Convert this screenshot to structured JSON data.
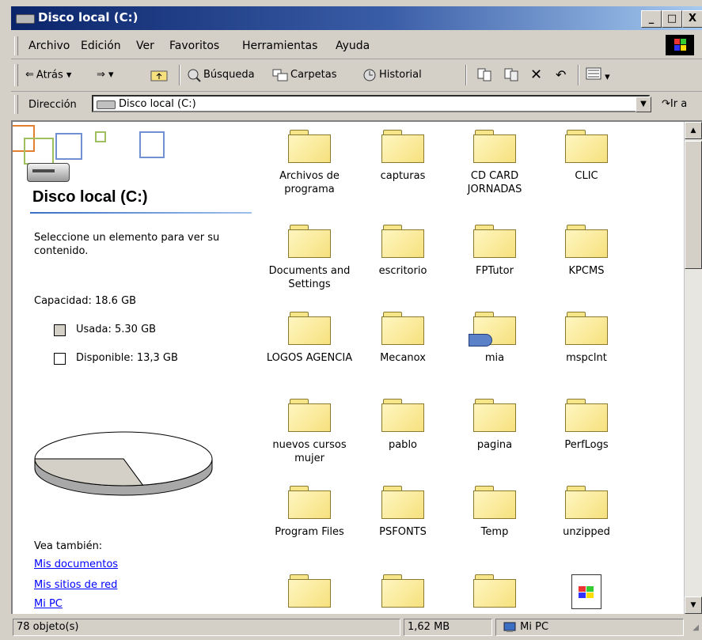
{
  "window": {
    "title": "Disco local (C:)",
    "minimize": "_",
    "maximize": "□",
    "close": "X"
  },
  "menu": [
    "Archivo",
    "Edición",
    "Ver",
    "Favoritos",
    "Herramientas",
    "Ayuda"
  ],
  "toolbar": {
    "back": "Atrás",
    "search": "Búsqueda",
    "folders": "Carpetas",
    "history": "Historial"
  },
  "address": {
    "label": "Dirección",
    "value": "Disco local (C:)",
    "go": "Ir a"
  },
  "leftpanel": {
    "title": "Disco local (C:)",
    "hint": "Seleccione un elemento para ver su contenido.",
    "capacity": "Capacidad: 18.6 GB",
    "used": "Usada: 5.30 GB",
    "free": "Disponible: 13,3 GB",
    "see_also": "Vea también:",
    "links": [
      "Mis documentos",
      "Mis sitios de red",
      "Mi PC"
    ]
  },
  "disk_usage": {
    "used_gb": 5.3,
    "free_gb": 13.3,
    "used_color": "#d4d0c8",
    "free_color": "#ffffff"
  },
  "items": [
    "Archivos de programa",
    "capturas",
    "CD CARD JORNADAS",
    "CLIC",
    "Documents and Settings",
    "escritorio",
    "FPTutor",
    "KPCMS",
    "LOGOS AGENCIA",
    "Mecanox",
    "mia",
    "mspclnt",
    "nuevos cursos mujer",
    "pablo",
    "pagina",
    "PerfLogs",
    "Program Files",
    "PSFONTS",
    "Temp",
    "unzipped",
    "",
    "",
    "",
    ""
  ],
  "status": {
    "count": "78 objeto(s)",
    "size": "1,62 MB",
    "location": "Mi PC"
  }
}
